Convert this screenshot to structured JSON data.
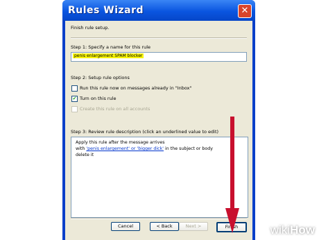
{
  "window": {
    "title": "Rules Wizard"
  },
  "header": {
    "text": "Finish rule setup."
  },
  "step1": {
    "label": "Step 1: Specify a name for this rule",
    "name_value": "penis enlargement SPAM blocker"
  },
  "step2": {
    "label": "Step 2: Setup rule options",
    "options": [
      {
        "label": "Run this rule now on messages already in \"Inbox\"",
        "checked": false,
        "enabled": true
      },
      {
        "label": "Turn on this rule",
        "checked": true,
        "enabled": true
      },
      {
        "label": "Create this rule on all accounts",
        "checked": false,
        "enabled": false
      }
    ]
  },
  "step3": {
    "label": "Step 3: Review rule description (click an underlined value to edit)",
    "line1": "Apply this rule after the message arrives",
    "line2_prefix": "with ",
    "line2_link": "'penis enlargement' or 'bigger dick'",
    "line2_suffix": " in the subject or body",
    "line3": "delete it"
  },
  "buttons": {
    "cancel": "Cancel",
    "back": "< Back",
    "next": "Next >",
    "finish": "Finish"
  },
  "watermark": {
    "prefix": "wiki",
    "suffix": "How"
  },
  "colors": {
    "titlebar": "#0a55e0",
    "client": "#ece9d8",
    "arrow": "#c8102e",
    "highlight": "#f7f40a"
  }
}
